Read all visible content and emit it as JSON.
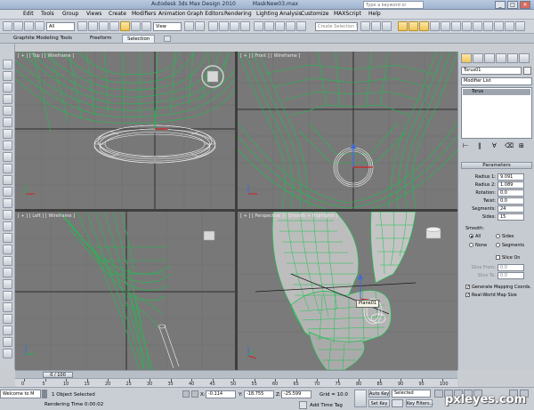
{
  "app": {
    "title": "Autodesk 3ds Max Design 2010",
    "file": "MaskNew03.max",
    "help_search_placeholder": "Type a keyword or phrase",
    "window_buttons": [
      "_",
      "□",
      "✕"
    ]
  },
  "menu": [
    "Edit",
    "Tools",
    "Group",
    "Views",
    "Create",
    "Modifiers",
    "Animation",
    "Graph Editors",
    "Rendering",
    "Lighting Analysis",
    "Customize",
    "MAXScript",
    "Help"
  ],
  "toolbar": {
    "selection_filter": "All",
    "ref_coord": "View",
    "selection_set_placeholder": "Create Selection Se"
  },
  "ribbon": {
    "tabs": [
      "Graphite Modeling Tools",
      "Freeform",
      "Selection"
    ],
    "active_tab": "Selection"
  },
  "viewports": {
    "top": "[ + ] [ Top ] [ Wireframe ]",
    "front": "[ + ] [ Front ] [ Wireframe ]",
    "left": "[ + ] [ Left ] [ Wireframe ]",
    "perspective": "[ + ] [ Perspective ] [ Smooth + Highlights ]",
    "object_tag": "Plane01"
  },
  "colors": {
    "viewport_bg": "#787878",
    "wire_green": "#19c24c",
    "wire_white": "#f2f2f2",
    "active_border": "#e7d64a",
    "grid_dark": "#2b2b2b"
  },
  "command_panel": {
    "object_name": "Torus01",
    "modifier_list": "Modifier List",
    "stack": [
      "Torus"
    ],
    "rollout": "Parameters",
    "params": [
      {
        "label": "Radius 1:",
        "value": "9.091"
      },
      {
        "label": "Radius 2:",
        "value": "1.089"
      },
      {
        "label": "Rotation:",
        "value": "0.0"
      },
      {
        "label": "Twist:",
        "value": "0.0"
      },
      {
        "label": "Segments:",
        "value": "24"
      },
      {
        "label": "Sides:",
        "value": "15"
      }
    ],
    "smooth_label": "Smooth:",
    "smooth_options": [
      "All",
      "Sides",
      "None",
      "Segments"
    ],
    "smooth_selected": "All",
    "slice_on": "Slice On",
    "slice_from": {
      "label": "Slice From:",
      "value": "0.0"
    },
    "slice_to": {
      "label": "Slice To:",
      "value": "0.0"
    },
    "gen_mapping": "Generate Mapping Coords.",
    "real_world": "Real-World Map Size"
  },
  "timeline": {
    "slider": "0 / 100",
    "ticks": [
      "0",
      "5",
      "10",
      "15",
      "20",
      "25",
      "30",
      "35",
      "40",
      "45",
      "50",
      "55",
      "60",
      "65",
      "70",
      "75",
      "80",
      "85",
      "90",
      "95",
      "100"
    ]
  },
  "status": {
    "maxscript": "Welcome to M",
    "selected": "1 Object Selected",
    "render_time": "Rendering Time  0:00:02",
    "x_label": "X:",
    "x": "-0.114",
    "y_label": "Y:",
    "y": "-18.755",
    "z_label": "Z:",
    "z": "-25.599",
    "grid": "Grid = 10.0",
    "add_time_tag": "Add Time Tag",
    "auto_key": "Auto Key",
    "set_key": "Set Key",
    "key_mode": "Selected",
    "key_filters": "Key Filters..."
  },
  "watermark": "pxleyes.com"
}
